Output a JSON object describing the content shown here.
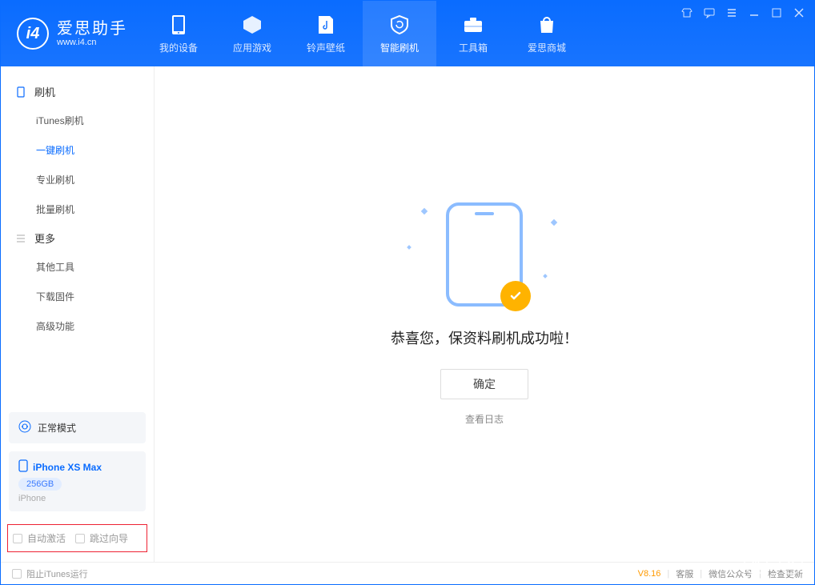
{
  "app": {
    "title": "爱思助手",
    "subtitle": "www.i4.cn"
  },
  "tabs": {
    "device": "我的设备",
    "apps": "应用游戏",
    "ring": "铃声壁纸",
    "flash": "智能刷机",
    "tools": "工具箱",
    "store": "爱思商城"
  },
  "sidebar": {
    "group1": "刷机",
    "items1": {
      "itunes": "iTunes刷机",
      "oneclick": "一键刷机",
      "pro": "专业刷机",
      "batch": "批量刷机"
    },
    "group2": "更多",
    "items2": {
      "other": "其他工具",
      "firmware": "下载固件",
      "advanced": "高级功能"
    }
  },
  "device": {
    "mode": "正常模式",
    "name": "iPhone XS Max",
    "storage": "256GB",
    "type": "iPhone"
  },
  "options": {
    "auto_activate": "自动激活",
    "skip_guide": "跳过向导"
  },
  "main": {
    "message": "恭喜您，保资料刷机成功啦！",
    "ok": "确定",
    "log": "查看日志"
  },
  "footer": {
    "block_itunes": "阻止iTunes运行",
    "version": "V8.16",
    "service": "客服",
    "wechat": "微信公众号",
    "update": "检查更新"
  }
}
